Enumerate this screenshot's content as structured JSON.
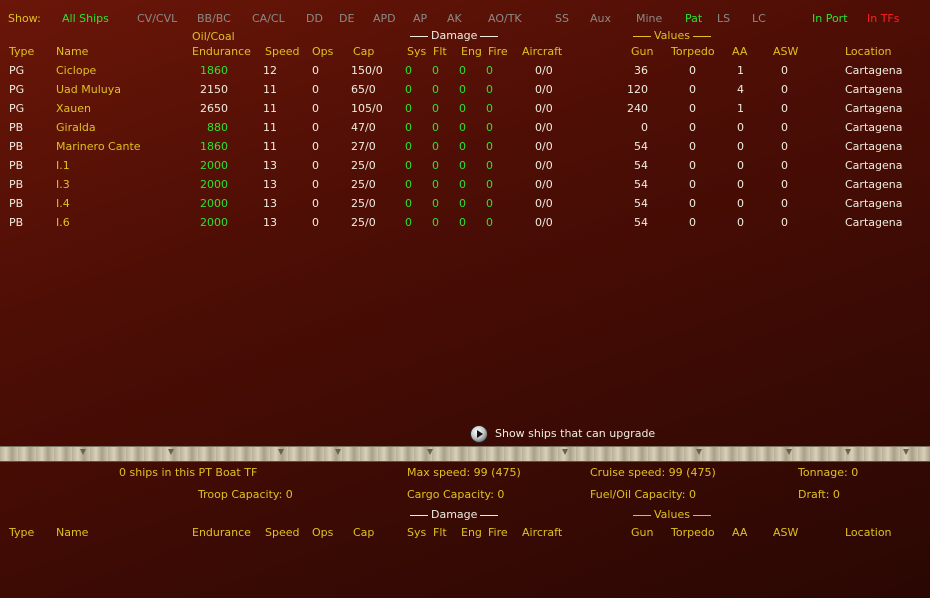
{
  "filters": {
    "show_label": "Show:",
    "all_ships": "All Ships",
    "types": [
      "CV/CVL",
      "BB/BC",
      "CA/CL",
      "DD",
      "DE",
      "APD",
      "AP",
      "AK",
      "AO/TK",
      "SS",
      "Aux",
      "Mine"
    ],
    "pat": "Pat",
    "ls": "LS",
    "lc": "LC",
    "in_port": "In Port",
    "in_tfs": "In TFs"
  },
  "table": {
    "group_oil": "Oil/Coal",
    "group_damage": "Damage",
    "group_values": "Values",
    "columns": {
      "type": "Type",
      "name": "Name",
      "endurance": "Endurance",
      "speed": "Speed",
      "ops": "Ops",
      "cap": "Cap",
      "sys": "Sys",
      "flt": "Flt",
      "eng": "Eng",
      "fire": "Fire",
      "aircraft": "Aircraft",
      "gun": "Gun",
      "torpedo": "Torpedo",
      "aa": "AA",
      "asw": "ASW",
      "location": "Location"
    },
    "rows": [
      {
        "type": "PG",
        "name": "Ciclope",
        "endurance": "1860",
        "endurance_color": "green",
        "speed": "12",
        "ops": "0",
        "cap": "150/0",
        "sys": "0",
        "flt": "0",
        "eng": "0",
        "fire": "0",
        "aircraft": "0/0",
        "gun": "36",
        "torpedo": "0",
        "aa": "1",
        "asw": "0",
        "location": "Cartagena"
      },
      {
        "type": "PG",
        "name": "Uad Muluya",
        "endurance": "2150",
        "endurance_color": "white",
        "speed": "11",
        "ops": "0",
        "cap": "65/0",
        "sys": "0",
        "flt": "0",
        "eng": "0",
        "fire": "0",
        "aircraft": "0/0",
        "gun": "120",
        "torpedo": "0",
        "aa": "4",
        "asw": "0",
        "location": "Cartagena"
      },
      {
        "type": "PG",
        "name": "Xauen",
        "endurance": "2650",
        "endurance_color": "white",
        "speed": "11",
        "ops": "0",
        "cap": "105/0",
        "sys": "0",
        "flt": "0",
        "eng": "0",
        "fire": "0",
        "aircraft": "0/0",
        "gun": "240",
        "torpedo": "0",
        "aa": "1",
        "asw": "0",
        "location": "Cartagena"
      },
      {
        "type": "PB",
        "name": "Giralda",
        "endurance": "880",
        "endurance_color": "green",
        "speed": "11",
        "ops": "0",
        "cap": "47/0",
        "sys": "0",
        "flt": "0",
        "eng": "0",
        "fire": "0",
        "aircraft": "0/0",
        "gun": "0",
        "torpedo": "0",
        "aa": "0",
        "asw": "0",
        "location": "Cartagena"
      },
      {
        "type": "PB",
        "name": "Marinero Cante",
        "endurance": "1860",
        "endurance_color": "green",
        "speed": "11",
        "ops": "0",
        "cap": "27/0",
        "sys": "0",
        "flt": "0",
        "eng": "0",
        "fire": "0",
        "aircraft": "0/0",
        "gun": "54",
        "torpedo": "0",
        "aa": "0",
        "asw": "0",
        "location": "Cartagena"
      },
      {
        "type": "PB",
        "name": "I.1",
        "endurance": "2000",
        "endurance_color": "green",
        "speed": "13",
        "ops": "0",
        "cap": "25/0",
        "sys": "0",
        "flt": "0",
        "eng": "0",
        "fire": "0",
        "aircraft": "0/0",
        "gun": "54",
        "torpedo": "0",
        "aa": "0",
        "asw": "0",
        "location": "Cartagena"
      },
      {
        "type": "PB",
        "name": "I.3",
        "endurance": "2000",
        "endurance_color": "green",
        "speed": "13",
        "ops": "0",
        "cap": "25/0",
        "sys": "0",
        "flt": "0",
        "eng": "0",
        "fire": "0",
        "aircraft": "0/0",
        "gun": "54",
        "torpedo": "0",
        "aa": "0",
        "asw": "0",
        "location": "Cartagena"
      },
      {
        "type": "PB",
        "name": "I.4",
        "endurance": "2000",
        "endurance_color": "green",
        "speed": "13",
        "ops": "0",
        "cap": "25/0",
        "sys": "0",
        "flt": "0",
        "eng": "0",
        "fire": "0",
        "aircraft": "0/0",
        "gun": "54",
        "torpedo": "0",
        "aa": "0",
        "asw": "0",
        "location": "Cartagena"
      },
      {
        "type": "PB",
        "name": "I.6",
        "endurance": "2000",
        "endurance_color": "green",
        "speed": "13",
        "ops": "0",
        "cap": "25/0",
        "sys": "0",
        "flt": "0",
        "eng": "0",
        "fire": "0",
        "aircraft": "0/0",
        "gun": "54",
        "torpedo": "0",
        "aa": "0",
        "asw": "0",
        "location": "Cartagena"
      }
    ]
  },
  "upgrade": {
    "label": "Show ships that can upgrade"
  },
  "tf": {
    "ships_count": "0 ships in this PT Boat TF",
    "max_speed": "Max speed: 99 (475)",
    "cruise_speed": "Cruise speed: 99 (475)",
    "tonnage": "Tonnage: 0",
    "troop_capacity": "Troop Capacity: 0",
    "cargo_capacity": "Cargo Capacity: 0",
    "fuel_capacity": "Fuel/Oil Capacity: 0",
    "draft": "Draft: 0"
  },
  "tf_table": {
    "group_damage": "Damage",
    "group_values": "Values",
    "columns": {
      "type": "Type",
      "name": "Name",
      "endurance": "Endurance",
      "speed": "Speed",
      "ops": "Ops",
      "cap": "Cap",
      "sys": "Sys",
      "flt": "Flt",
      "eng": "Eng",
      "fire": "Fire",
      "aircraft": "Aircraft",
      "gun": "Gun",
      "torpedo": "Torpedo",
      "aa": "AA",
      "asw": "ASW",
      "location": "Location"
    }
  },
  "colors": {
    "yellow": "#e0c020",
    "green": "#30e030",
    "red": "#ff2020",
    "grey": "#8c8a86",
    "white": "#f0ece0"
  }
}
